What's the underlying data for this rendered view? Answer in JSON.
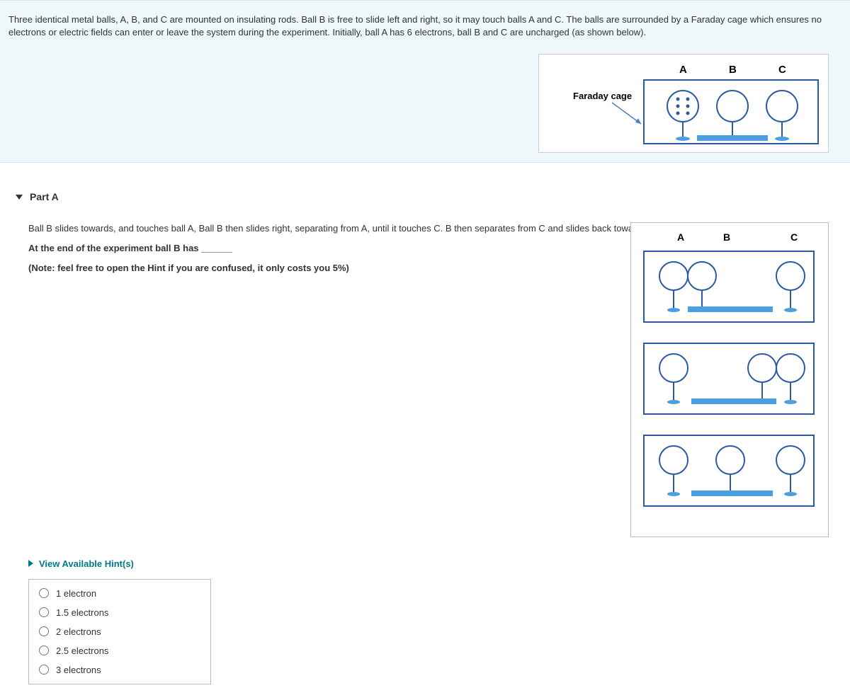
{
  "intro": {
    "text": "Three identical metal balls, A, B, and C are mounted on insulating rods. Ball B is free to slide left and right, so it may touch balls A and C. The balls are surrounded by a Faraday cage which ensures no electrons or electric fields can enter or leave the system during the experiment. Initially, ball A has 6 electrons, ball B and C are uncharged (as shown below).",
    "figure": {
      "faraday_label": "Faraday cage",
      "labelA": "A",
      "labelB": "B",
      "labelC": "C"
    }
  },
  "partA": {
    "title": "Part A",
    "line1": "Ball B slides towards, and touches ball A, Ball B then slides right, separating from A, until it touches C. B then separates from C and slides back towards the middle.",
    "line2_prefix": "At the end of the experiment ball B has ",
    "line2_blank": "______",
    "line3": "(Note: feel free to open the Hint if you are confused, it only costs you 5%)",
    "side_figure": {
      "labelA": "A",
      "labelB": "B",
      "labelC": "C"
    },
    "hints_label": "View Available Hint(s)",
    "options": [
      "1 electron",
      "1.5 electrons",
      "2 electrons",
      "2.5 electrons",
      "3 electrons"
    ]
  }
}
